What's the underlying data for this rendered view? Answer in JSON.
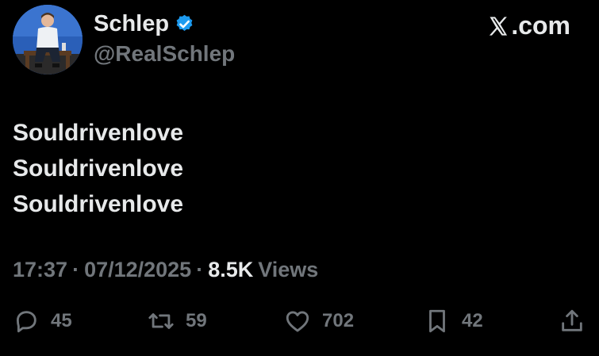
{
  "author": {
    "display_name": "Schlep",
    "handle": "@RealSchlep",
    "verified": true,
    "avatar": "avatar-photo"
  },
  "brand": {
    "logo": "x-logo-icon",
    "domain": ".com"
  },
  "tweet": {
    "lines": [
      "Souldrivenlove",
      "Souldrivenlove",
      "Souldrivenlove"
    ]
  },
  "meta": {
    "time": "17:37",
    "separator": "·",
    "date": "07/12/2025",
    "views_count": "8.5K",
    "views_label": "Views"
  },
  "actions": {
    "replies": "45",
    "reposts": "59",
    "likes": "702",
    "bookmarks": "42"
  },
  "colors": {
    "background": "#000000",
    "text_primary": "#e7e9ea",
    "text_secondary": "#71767b",
    "verified_badge": "#1d9bf0"
  }
}
